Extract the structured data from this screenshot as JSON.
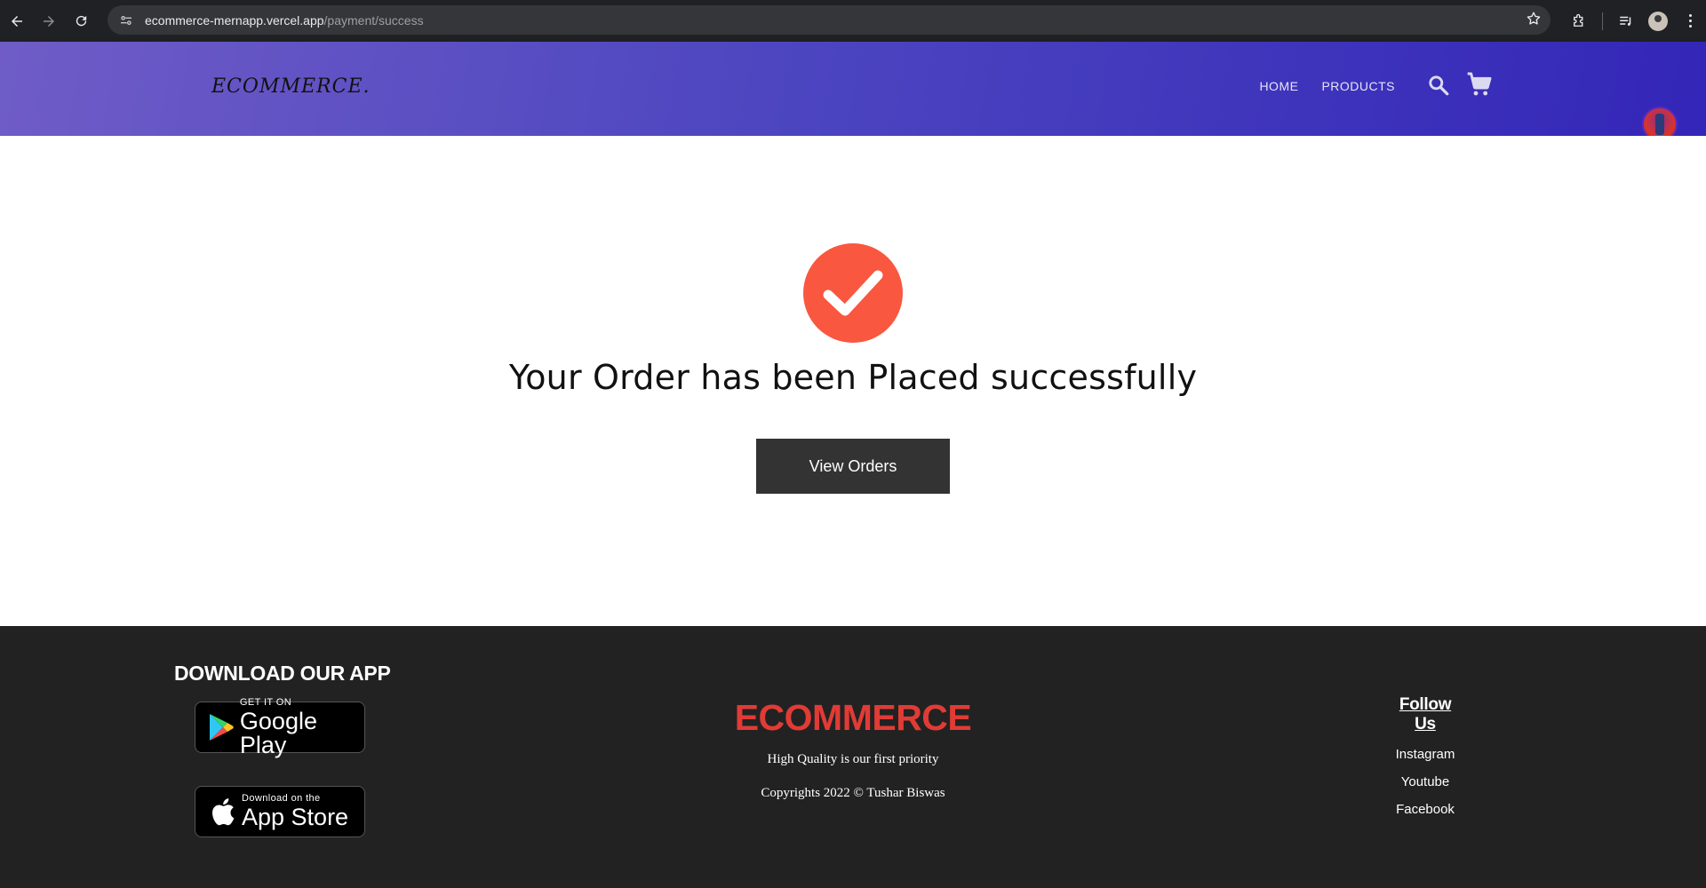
{
  "browser": {
    "url_host": "ecommerce-mernapp.vercel.app",
    "url_path": "/payment/success"
  },
  "header": {
    "logo": "ECOMMERCE.",
    "nav": [
      {
        "label": "HOME"
      },
      {
        "label": "PRODUCTS"
      }
    ]
  },
  "main": {
    "message": "Your Order has been Placed successfully",
    "button_label": "View Orders"
  },
  "footer": {
    "download_title": "DOWNLOAD OUR APP",
    "google_play": {
      "small": "GET IT ON",
      "big": "Google Play"
    },
    "app_store": {
      "small": "Download on the",
      "big": "App Store"
    },
    "brand": "ECOMMERCE",
    "tagline": "High Quality is our first priority",
    "copyright": "Copyrights 2022 © Tushar Biswas",
    "follow_title": "Follow Us",
    "social": [
      {
        "label": "Instagram"
      },
      {
        "label": "Youtube"
      },
      {
        "label": "Facebook"
      }
    ]
  },
  "colors": {
    "header_gradient_start": "#6f5cc7",
    "header_gradient_end": "#3326b8",
    "check_circle": "#f9573f",
    "button_bg": "#333333",
    "footer_bg": "#222222",
    "brand_red": "#e13b36"
  },
  "icons": [
    "back-icon",
    "forward-icon",
    "reload-icon",
    "site-info-icon",
    "bookmark-star-icon",
    "extensions-icon",
    "media-icon",
    "profile-icon",
    "menu-icon",
    "search-icon",
    "cart-icon",
    "check-icon",
    "google-play-icon",
    "apple-icon"
  ]
}
